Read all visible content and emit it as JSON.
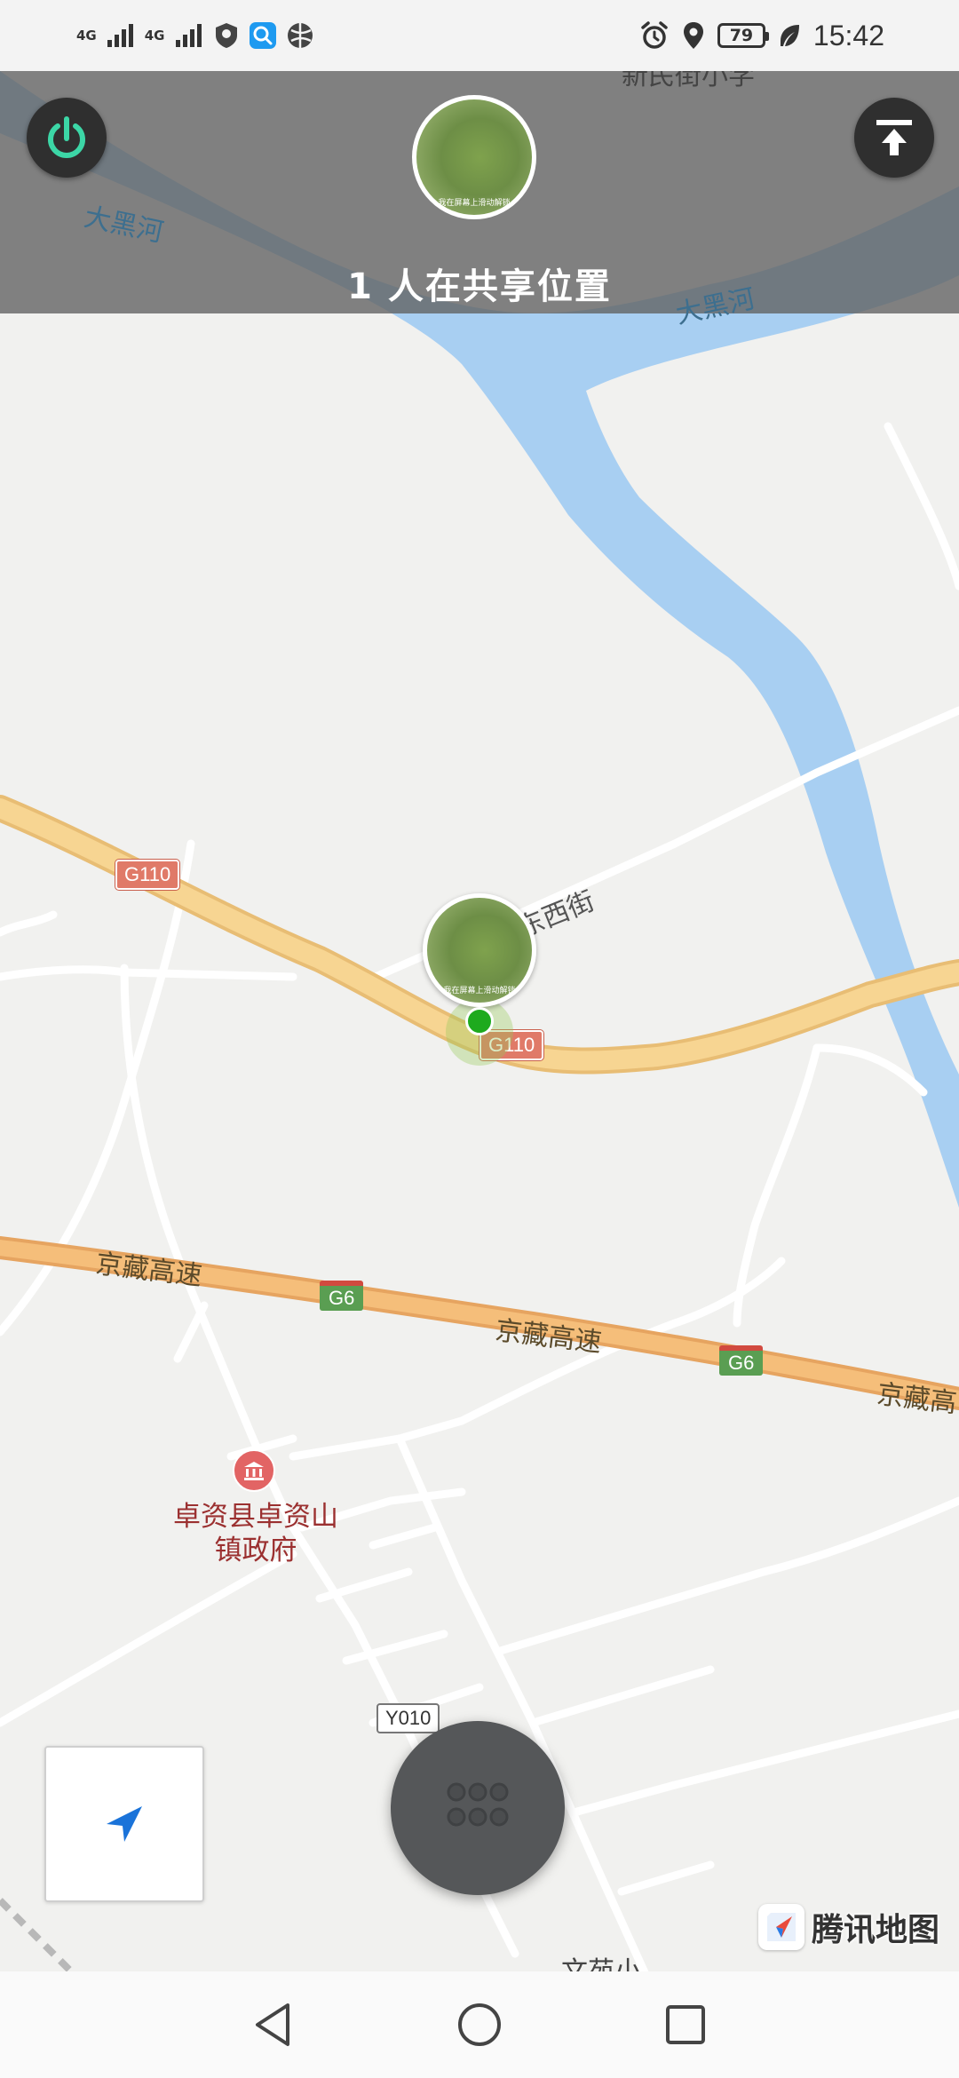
{
  "status_bar": {
    "network_1": "4G",
    "network_2": "4G",
    "battery": "79",
    "time": "15:42"
  },
  "header": {
    "share_count_text": "1 人在共享位置",
    "avatar_caption": "我在屏幕上滑动解锁"
  },
  "map": {
    "labels": {
      "top_cut_label": "新民街小学",
      "river_left": "大黑河",
      "river_right": "大黑河",
      "street": "东西街",
      "expressway_1": "京藏高速",
      "expressway_2": "京藏高速",
      "expressway_3": "京藏高",
      "poi_name": "卓资县卓资山镇政府",
      "bottom_cut_label": "文苑小"
    },
    "shields": {
      "g110_a": "G110",
      "g110_b": "G110",
      "g6_a": "G6",
      "g6_b": "G6",
      "y010": "Y010"
    },
    "brand": "腾讯地图"
  },
  "colors": {
    "river": "#a8cff2",
    "road_major": "#f7d592",
    "road_expressway": "#f5be7a",
    "location_dot": "#1eaa1e",
    "power_icon": "#3cd6a6"
  },
  "icons": {
    "power": "power-icon",
    "upload": "upload-icon",
    "locate": "navigation-arrow-icon",
    "menu": "grid-dots-icon"
  }
}
